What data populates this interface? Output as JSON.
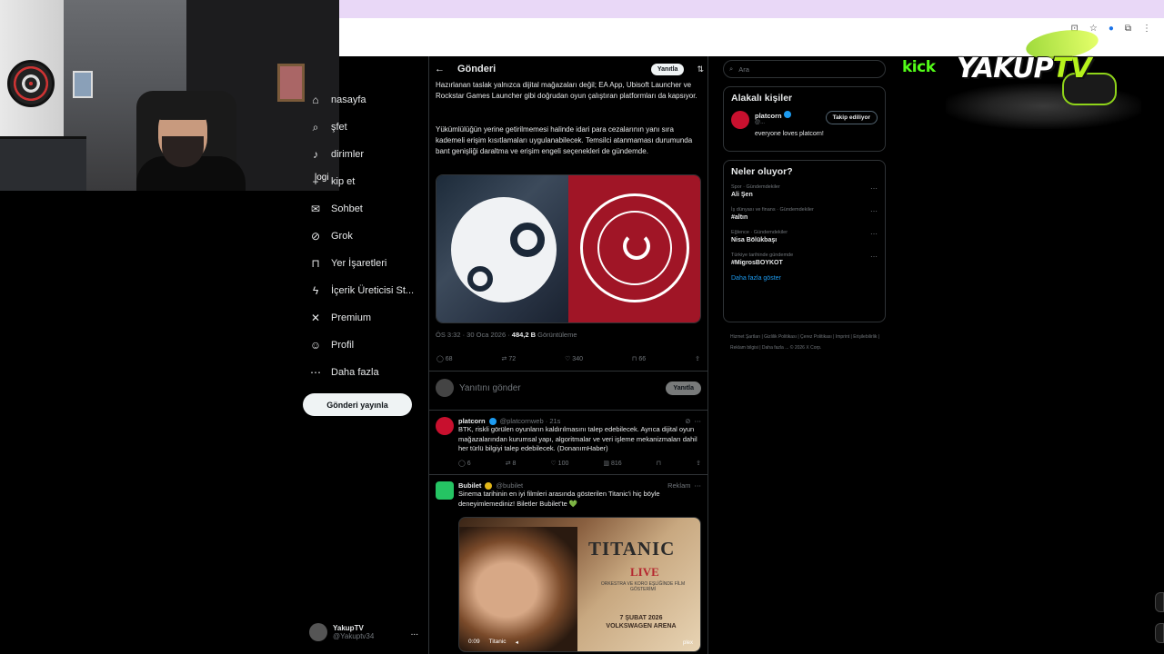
{
  "webcam": {
    "overlay_text": "logi"
  },
  "sidebar": {
    "items": [
      {
        "label": "nasayfa",
        "icon": "home-icon"
      },
      {
        "label": "şfet",
        "icon": "search-icon"
      },
      {
        "label": "dirimler",
        "icon": "bell-icon"
      },
      {
        "label": "kip et",
        "icon": "follow-icon"
      },
      {
        "label": "Sohbet",
        "icon": "mail-icon"
      },
      {
        "label": "Grok",
        "icon": "grok-icon"
      },
      {
        "label": "Yer İşaretleri",
        "icon": "bookmark-icon"
      },
      {
        "label": "İçerik Üreticisi St...",
        "icon": "lightning-icon"
      },
      {
        "label": "Premium",
        "icon": "x-logo-icon"
      },
      {
        "label": "Profil",
        "icon": "person-icon"
      },
      {
        "label": "Daha fazla",
        "icon": "more-circle-icon"
      }
    ],
    "post_button": "Gönderi yayınla",
    "account": {
      "name": "YakupTV",
      "handle": "@Yakuptv34",
      "more": "..."
    }
  },
  "main": {
    "back": "←",
    "title": "Gönderi",
    "reply_pill": "Yanıtla",
    "filter": "⇅",
    "paragraph1": "Hazırlanan taslak yalnızca dijital mağazaları değil; EA App, Ubisoft Launcher ve Rockstar Games Launcher gibi doğrudan oyun çalıştıran platformları da kapsıyor.",
    "paragraph2": "Yükümlülüğün yerine getirilmemesi halinde idari para cezalarının yanı sıra kademeli erişim kısıtlamaları uygulanabilecek. Temsilci atanmaması durumunda bant genişliği daraltma ve erişim engeli seçenekleri de gündemde.",
    "meta_time": "ÖS 3:32 · 30 Oca 2026 · ",
    "meta_views": "484,2 B",
    "meta_views_label": " Görüntüleme",
    "actions": {
      "replies": "68",
      "reposts": "72",
      "likes": "340",
      "bookmarks": "66"
    },
    "reply_placeholder": "Yanıtını gönder",
    "reply_button": "Yanıtla"
  },
  "reply1": {
    "name": "platcorn",
    "handle": "@platcornweb · 21s",
    "text": "BTK, riskli görülen oyunların kaldırılmasını talep edebilecek. Ayrıca dijital oyun mağazalarından kurumsal yapı, algoritmalar ve veri işleme mekanizmaları dahil her türlü bilgiyi talep edebilecek. (DonanımHaber)",
    "replies": "6",
    "reposts": "8",
    "likes": "100",
    "views": "816"
  },
  "ad": {
    "name": "Bubilet",
    "handle": "@bubilet",
    "label": "Reklam",
    "text": "Sinema tarihinin en iyi filmleri arasında gösterilen Titanic'i hiç böyle deneyimlemediniz! Biletler Bubilet'te 💚",
    "poster_title": "TITANIC",
    "poster_live": "LIVE",
    "poster_sub": "ORKESTRA VE KORO EŞLİĞİNDE FİLM GÖSTERİMİ",
    "poster_date": "7 ŞUBAT 2026",
    "poster_venue": "VOLKSWAGEN ARENA",
    "video_time": "0:09",
    "video_title": "Titanic",
    "video_brand": "plex"
  },
  "right": {
    "search_placeholder": "Ara",
    "who_title": "Alakalı kişiler",
    "person": {
      "name": "platcorn",
      "handle": "@...",
      "follow": "Takip ediliyor",
      "bio": "everyone loves platcorn!"
    },
    "trends_title": "Neler oluyor?",
    "trends": [
      {
        "cat": "Spor · Gündemdekiler",
        "name": "Ali Şen"
      },
      {
        "cat": "İş dünyası ve finans · Gündemdekiler",
        "name": "#altın"
      },
      {
        "cat": "Eğlence · Gündemdekiler",
        "name": "Nisa Bölükbaşı"
      },
      {
        "cat": "Türkiye tarihinde gündemde",
        "name": "#MigrosBOYKOT"
      }
    ],
    "show_more": "Daha fazla göster",
    "footer": "Hizmet Şartları | Gizlilik Politikası | Çerez Politikası | Imprint | Erişilebilirlik | Reklam bilgisi | Daha fazla ... © 2026 X Corp."
  },
  "branding": {
    "kick": "kick",
    "yakup": "YAKUP",
    "tv": "TV"
  },
  "colors": {
    "kick_green": "#53fc18",
    "x_blue": "#1d9bf0",
    "chrome_top": "#e9d8f7"
  }
}
